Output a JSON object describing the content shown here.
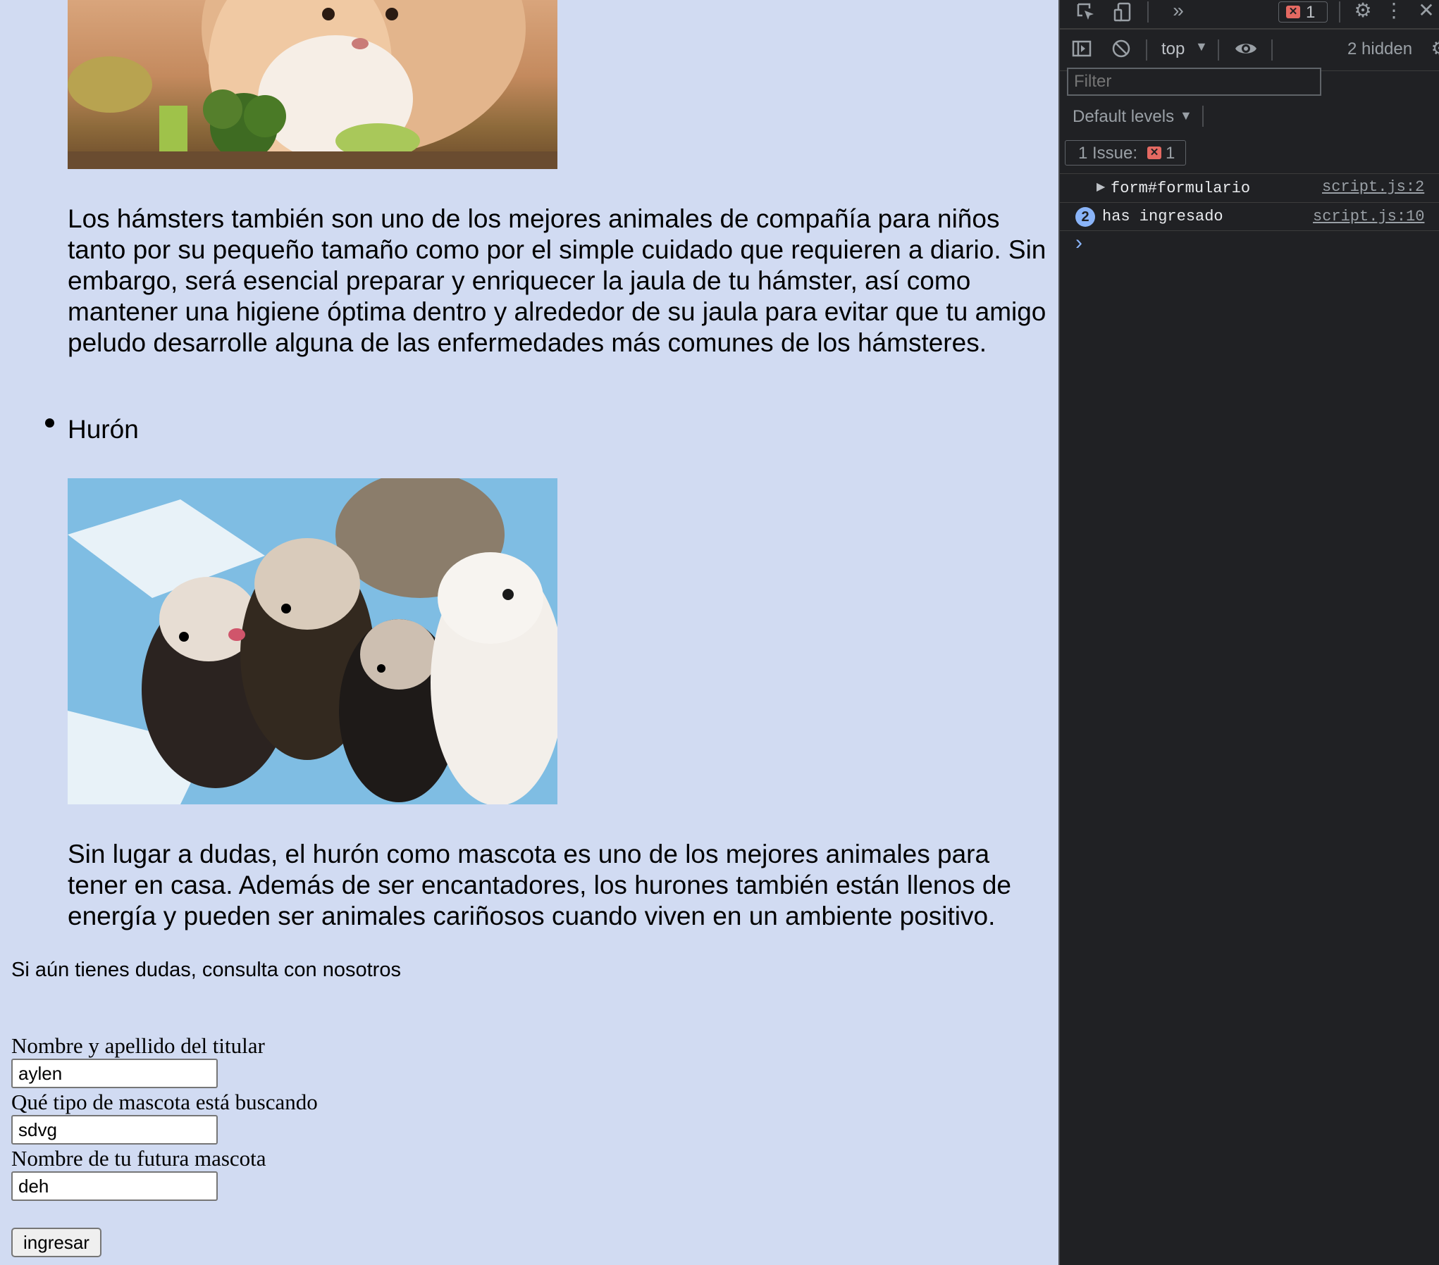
{
  "page": {
    "hamster_paragraph": "Los hámsters también son uno de los mejores animales de compañía para niños tanto por su pequeño tamaño como por el simple cuidado que requieren a diario. Sin embargo, será esencial preparar y enriquecer la jaula de tu hámster, así como mantener una higiene óptima dentro y alrededor de su jaula para evitar que tu amigo peludo desarrolle alguna de las enfermedades más comunes de los hámsteres.",
    "ferret_heading": "Hurón",
    "ferret_paragraph": "Sin lugar a dudas, el hurón como mascota es uno de los mejores animales para tener en casa. Además de ser encantadores, los hurones también están llenos de energía y pueden ser animales cariñosos cuando viven en un ambiente positivo.",
    "consult_text": "Si aún tienes dudas, consulta con nosotros",
    "form": {
      "name_label": "Nombre y apellido del titular",
      "name_value": "aylen",
      "pet_type_label": "Qué tipo de mascota está buscando",
      "pet_type_value": "sdvg",
      "pet_name_label": "Nombre de tu futura mascota",
      "pet_name_value": "deh",
      "submit_label": "ingresar"
    }
  },
  "devtools": {
    "error_count": "1",
    "context": "top",
    "hidden_count": "2 hidden",
    "filter_placeholder": "Filter",
    "default_levels": "Default levels",
    "issues_label": "1 Issue:",
    "issues_count": "1",
    "logs": [
      {
        "text": "form#formulario",
        "source": "script.js:2"
      },
      {
        "count": "2",
        "text": "has ingresado",
        "source": "script.js:10"
      }
    ],
    "prompt": "›"
  }
}
